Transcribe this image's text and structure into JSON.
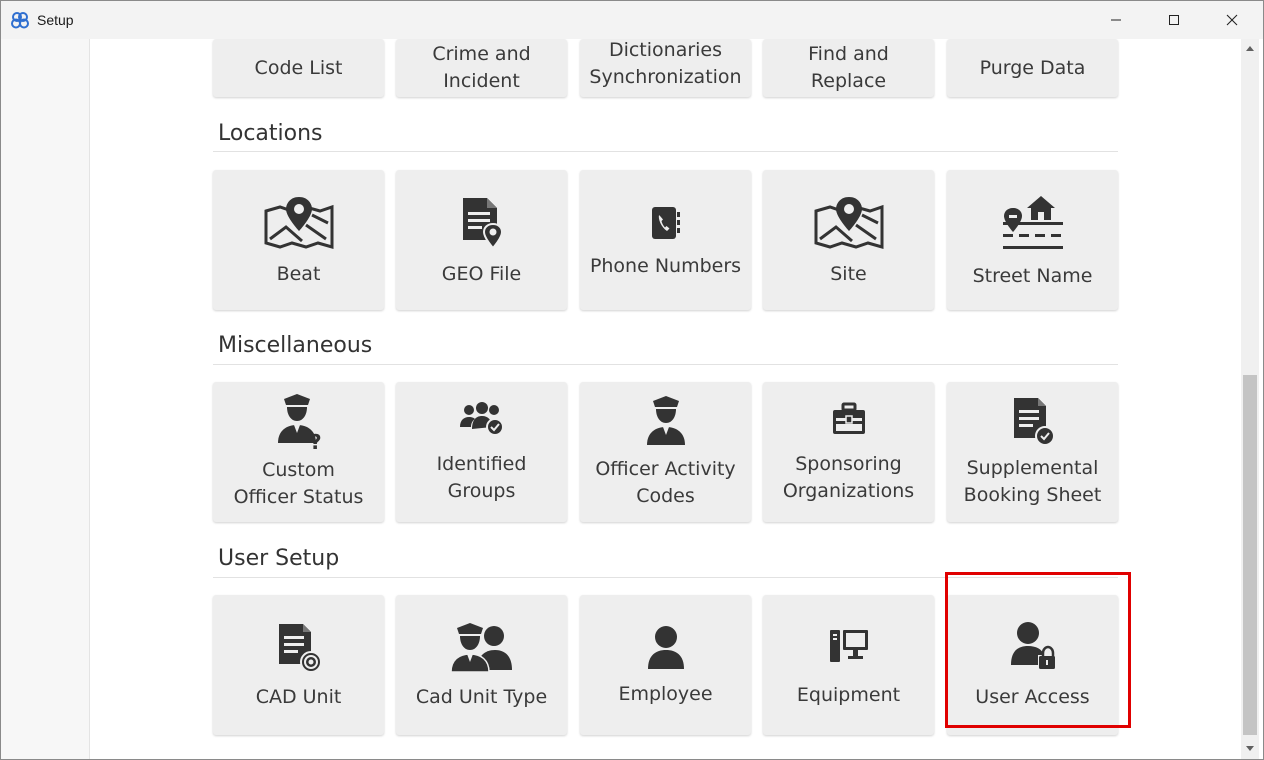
{
  "window": {
    "title": "Setup"
  },
  "top_row": [
    {
      "label": "Code List"
    },
    {
      "label": "Crime and Incident"
    },
    {
      "label": "Dictionaries Synchronization"
    },
    {
      "label": "Find and Replace"
    },
    {
      "label": "Purge Data"
    }
  ],
  "sections": {
    "locations": {
      "title": "Locations",
      "tiles": [
        {
          "label": "Beat",
          "icon": "map-pin-icon"
        },
        {
          "label": "GEO File",
          "icon": "geo-file-icon"
        },
        {
          "label": "Phone Numbers",
          "icon": "phone-book-icon"
        },
        {
          "label": "Site",
          "icon": "map-pin-icon"
        },
        {
          "label": "Street Name",
          "icon": "street-house-icon"
        }
      ]
    },
    "misc": {
      "title": "Miscellaneous",
      "tiles": [
        {
          "label": "Custom Officer Status",
          "icon": "officer-question-icon"
        },
        {
          "label": "Identified Groups",
          "icon": "group-check-icon"
        },
        {
          "label": "Officer Activity Codes",
          "icon": "officer-icon"
        },
        {
          "label": "Sponsoring Organizations",
          "icon": "briefcase-icon"
        },
        {
          "label": "Supplemental Booking Sheet",
          "icon": "document-check-icon"
        }
      ]
    },
    "user": {
      "title": "User Setup",
      "tiles": [
        {
          "label": "CAD Unit",
          "icon": "document-gear-icon"
        },
        {
          "label": "Cad Unit Type",
          "icon": "officer-pair-icon"
        },
        {
          "label": "Employee",
          "icon": "user-icon"
        },
        {
          "label": "Equipment",
          "icon": "computer-icon"
        },
        {
          "label": "User Access",
          "icon": "user-lock-icon"
        }
      ]
    }
  },
  "colors": {
    "tile_bg": "#eeeeee",
    "icon": "#333333",
    "highlight": "#e00000"
  }
}
